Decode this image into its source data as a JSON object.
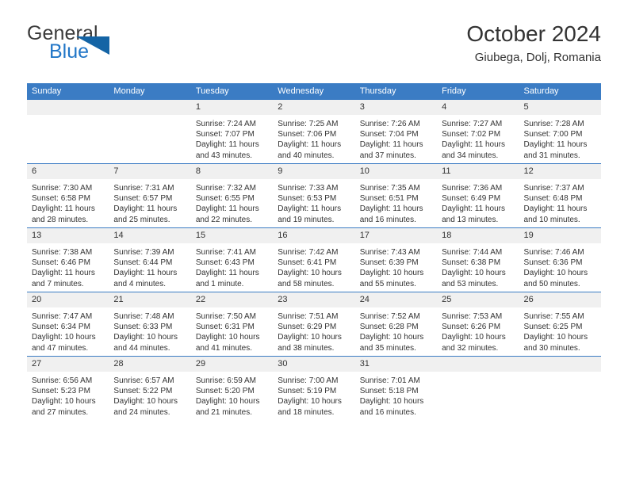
{
  "brand": {
    "logo_text_1": "General",
    "logo_text_2": "Blue",
    "logo_icon": "triangle-flag-icon",
    "accent_color": "#2176c7",
    "triangle_color": "#1464a5"
  },
  "header": {
    "title": "October 2024",
    "subtitle": "Giubega, Dolj, Romania"
  },
  "calendar": {
    "header_bg": "#3b7cc4",
    "daynum_bg": "#f0f0f0",
    "weekday_headers": [
      "Sunday",
      "Monday",
      "Tuesday",
      "Wednesday",
      "Thursday",
      "Friday",
      "Saturday"
    ],
    "weeks": [
      [
        {
          "day": "",
          "blank": true,
          "lines": []
        },
        {
          "day": "",
          "blank": true,
          "lines": []
        },
        {
          "day": "1",
          "lines": [
            "Sunrise: 7:24 AM",
            "Sunset: 7:07 PM",
            "Daylight: 11 hours",
            "and 43 minutes."
          ]
        },
        {
          "day": "2",
          "lines": [
            "Sunrise: 7:25 AM",
            "Sunset: 7:06 PM",
            "Daylight: 11 hours",
            "and 40 minutes."
          ]
        },
        {
          "day": "3",
          "lines": [
            "Sunrise: 7:26 AM",
            "Sunset: 7:04 PM",
            "Daylight: 11 hours",
            "and 37 minutes."
          ]
        },
        {
          "day": "4",
          "lines": [
            "Sunrise: 7:27 AM",
            "Sunset: 7:02 PM",
            "Daylight: 11 hours",
            "and 34 minutes."
          ]
        },
        {
          "day": "5",
          "lines": [
            "Sunrise: 7:28 AM",
            "Sunset: 7:00 PM",
            "Daylight: 11 hours",
            "and 31 minutes."
          ]
        }
      ],
      [
        {
          "day": "6",
          "lines": [
            "Sunrise: 7:30 AM",
            "Sunset: 6:58 PM",
            "Daylight: 11 hours",
            "and 28 minutes."
          ]
        },
        {
          "day": "7",
          "lines": [
            "Sunrise: 7:31 AM",
            "Sunset: 6:57 PM",
            "Daylight: 11 hours",
            "and 25 minutes."
          ]
        },
        {
          "day": "8",
          "lines": [
            "Sunrise: 7:32 AM",
            "Sunset: 6:55 PM",
            "Daylight: 11 hours",
            "and 22 minutes."
          ]
        },
        {
          "day": "9",
          "lines": [
            "Sunrise: 7:33 AM",
            "Sunset: 6:53 PM",
            "Daylight: 11 hours",
            "and 19 minutes."
          ]
        },
        {
          "day": "10",
          "lines": [
            "Sunrise: 7:35 AM",
            "Sunset: 6:51 PM",
            "Daylight: 11 hours",
            "and 16 minutes."
          ]
        },
        {
          "day": "11",
          "lines": [
            "Sunrise: 7:36 AM",
            "Sunset: 6:49 PM",
            "Daylight: 11 hours",
            "and 13 minutes."
          ]
        },
        {
          "day": "12",
          "lines": [
            "Sunrise: 7:37 AM",
            "Sunset: 6:48 PM",
            "Daylight: 11 hours",
            "and 10 minutes."
          ]
        }
      ],
      [
        {
          "day": "13",
          "lines": [
            "Sunrise: 7:38 AM",
            "Sunset: 6:46 PM",
            "Daylight: 11 hours",
            "and 7 minutes."
          ]
        },
        {
          "day": "14",
          "lines": [
            "Sunrise: 7:39 AM",
            "Sunset: 6:44 PM",
            "Daylight: 11 hours",
            "and 4 minutes."
          ]
        },
        {
          "day": "15",
          "lines": [
            "Sunrise: 7:41 AM",
            "Sunset: 6:43 PM",
            "Daylight: 11 hours",
            "and 1 minute."
          ]
        },
        {
          "day": "16",
          "lines": [
            "Sunrise: 7:42 AM",
            "Sunset: 6:41 PM",
            "Daylight: 10 hours",
            "and 58 minutes."
          ]
        },
        {
          "day": "17",
          "lines": [
            "Sunrise: 7:43 AM",
            "Sunset: 6:39 PM",
            "Daylight: 10 hours",
            "and 55 minutes."
          ]
        },
        {
          "day": "18",
          "lines": [
            "Sunrise: 7:44 AM",
            "Sunset: 6:38 PM",
            "Daylight: 10 hours",
            "and 53 minutes."
          ]
        },
        {
          "day": "19",
          "lines": [
            "Sunrise: 7:46 AM",
            "Sunset: 6:36 PM",
            "Daylight: 10 hours",
            "and 50 minutes."
          ]
        }
      ],
      [
        {
          "day": "20",
          "lines": [
            "Sunrise: 7:47 AM",
            "Sunset: 6:34 PM",
            "Daylight: 10 hours",
            "and 47 minutes."
          ]
        },
        {
          "day": "21",
          "lines": [
            "Sunrise: 7:48 AM",
            "Sunset: 6:33 PM",
            "Daylight: 10 hours",
            "and 44 minutes."
          ]
        },
        {
          "day": "22",
          "lines": [
            "Sunrise: 7:50 AM",
            "Sunset: 6:31 PM",
            "Daylight: 10 hours",
            "and 41 minutes."
          ]
        },
        {
          "day": "23",
          "lines": [
            "Sunrise: 7:51 AM",
            "Sunset: 6:29 PM",
            "Daylight: 10 hours",
            "and 38 minutes."
          ]
        },
        {
          "day": "24",
          "lines": [
            "Sunrise: 7:52 AM",
            "Sunset: 6:28 PM",
            "Daylight: 10 hours",
            "and 35 minutes."
          ]
        },
        {
          "day": "25",
          "lines": [
            "Sunrise: 7:53 AM",
            "Sunset: 6:26 PM",
            "Daylight: 10 hours",
            "and 32 minutes."
          ]
        },
        {
          "day": "26",
          "lines": [
            "Sunrise: 7:55 AM",
            "Sunset: 6:25 PM",
            "Daylight: 10 hours",
            "and 30 minutes."
          ]
        }
      ],
      [
        {
          "day": "27",
          "lines": [
            "Sunrise: 6:56 AM",
            "Sunset: 5:23 PM",
            "Daylight: 10 hours",
            "and 27 minutes."
          ]
        },
        {
          "day": "28",
          "lines": [
            "Sunrise: 6:57 AM",
            "Sunset: 5:22 PM",
            "Daylight: 10 hours",
            "and 24 minutes."
          ]
        },
        {
          "day": "29",
          "lines": [
            "Sunrise: 6:59 AM",
            "Sunset: 5:20 PM",
            "Daylight: 10 hours",
            "and 21 minutes."
          ]
        },
        {
          "day": "30",
          "lines": [
            "Sunrise: 7:00 AM",
            "Sunset: 5:19 PM",
            "Daylight: 10 hours",
            "and 18 minutes."
          ]
        },
        {
          "day": "31",
          "lines": [
            "Sunrise: 7:01 AM",
            "Sunset: 5:18 PM",
            "Daylight: 10 hours",
            "and 16 minutes."
          ]
        },
        {
          "day": "",
          "blank": true,
          "lines": []
        },
        {
          "day": "",
          "blank": true,
          "lines": []
        }
      ]
    ]
  }
}
